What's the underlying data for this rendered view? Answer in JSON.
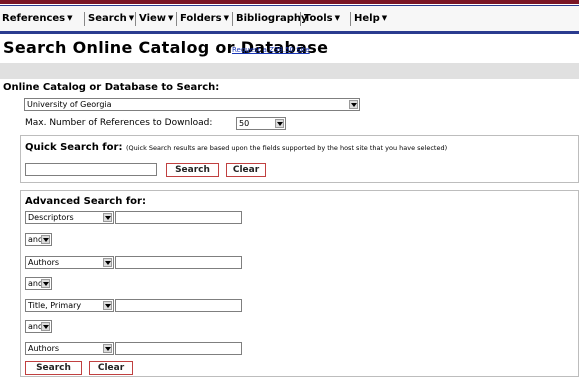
{
  "menu": {
    "references": "References",
    "search": "Search",
    "view": "View",
    "folders": "Folders",
    "bibliography": "Bibliography",
    "tools": "Tools",
    "help": "Help"
  },
  "page": {
    "title": "Search Online Catalog or Database",
    "request_link": "Request a Z39.50 Site"
  },
  "catalog": {
    "heading": "Online Catalog or Database to Search:",
    "selected": "University of Georgia",
    "max_label": "Max. Number of References to Download:",
    "max_value": "50"
  },
  "quick": {
    "heading": "Quick Search for:",
    "note": "(Quick Search results are based upon the fields supported by the host site that you have selected)",
    "value": "",
    "search_label": "Search",
    "clear_label": "Clear"
  },
  "advanced": {
    "heading": "Advanced Search for:",
    "rows": [
      {
        "field": "Descriptors",
        "value": ""
      },
      {
        "field": "Authors",
        "value": ""
      },
      {
        "field": "Title, Primary",
        "value": ""
      },
      {
        "field": "Authors",
        "value": ""
      }
    ],
    "operators": [
      "and",
      "and",
      "and"
    ],
    "search_label": "Search",
    "clear_label": "Clear"
  },
  "colors": {
    "menu_border": "#2a3b8f",
    "top_accent": "#7a1525",
    "button_border": "#c04040",
    "link": "#1a37b8"
  }
}
